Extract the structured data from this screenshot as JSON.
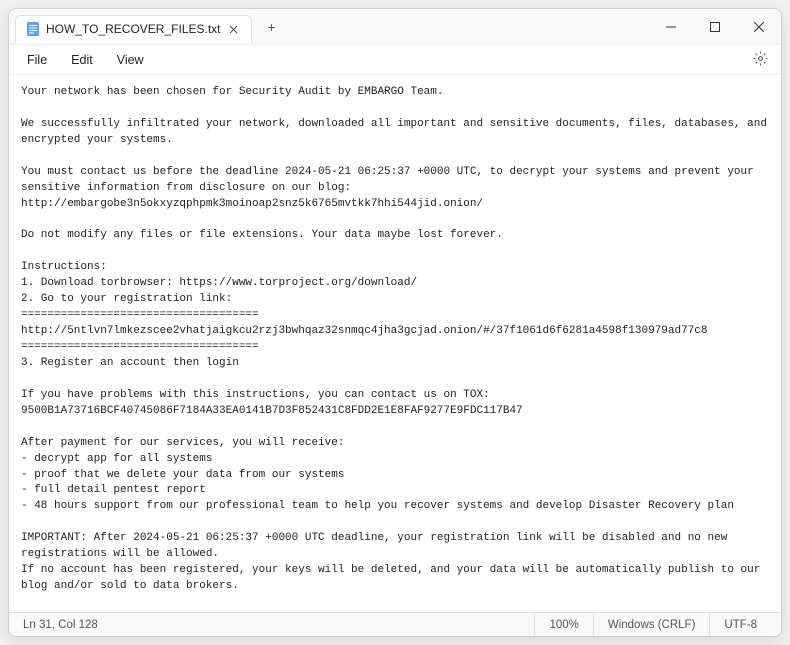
{
  "window": {
    "tab_title": "HOW_TO_RECOVER_FILES.txt"
  },
  "menu": {
    "file": "File",
    "edit": "Edit",
    "view": "View"
  },
  "content": {
    "text": "Your network has been chosen for Security Audit by EMBARGO Team.\n\nWe successfully infiltrated your network, downloaded all important and sensitive documents, files, databases, and encrypted your systems.\n\nYou must contact us before the deadline 2024-05-21 06:25:37 +0000 UTC, to decrypt your systems and prevent your sensitive information from disclosure on our blog:\nhttp://embargobe3n5okxyzqphpmk3moinoap2snz5k6765mvtkk7hhi544jid.onion/\n\nDo not modify any files or file extensions. Your data maybe lost forever.\n\nInstructions:\n1. Download torbrowser: https://www.torproject.org/download/\n2. Go to your registration link:\n====================================\nhttp://5ntlvn7lmkezscee2vhatjaigkcu2rzj3bwhqaz32snmqc4jha3gcjad.onion/#/37f1061d6f6281a4598f130979ad77c8\n====================================\n3. Register an account then login\n\nIf you have problems with this instructions, you can contact us on TOX:\n9500B1A73716BCF40745086F7184A33EA0141B7D3F852431C8FDD2E1E8FAF9277E9FDC117B47\n\nAfter payment for our services, you will receive:\n- decrypt app for all systems\n- proof that we delete your data from our systems\n- full detail pentest report\n- 48 hours support from our professional team to help you recover systems and develop Disaster Recovery plan\n\nIMPORTANT: After 2024-05-21 06:25:37 +0000 UTC deadline, your registration link will be disabled and no new registrations will be allowed.\nIf no account has been registered, your keys will be deleted, and your data will be automatically publish to our blog and/or sold to data brokers.\n\nWARNING: Speak for yourself. Our team has many years experience, and we will not waste time with professional negotiators.\nIf we suspect you to speaking by professional negotiators, your keys will be immediate deleted and data will be published/sold."
  },
  "statusbar": {
    "position": "Ln 31, Col 128",
    "zoom": "100%",
    "encoding_line": "Windows (CRLF)",
    "encoding_char": "UTF-8"
  }
}
